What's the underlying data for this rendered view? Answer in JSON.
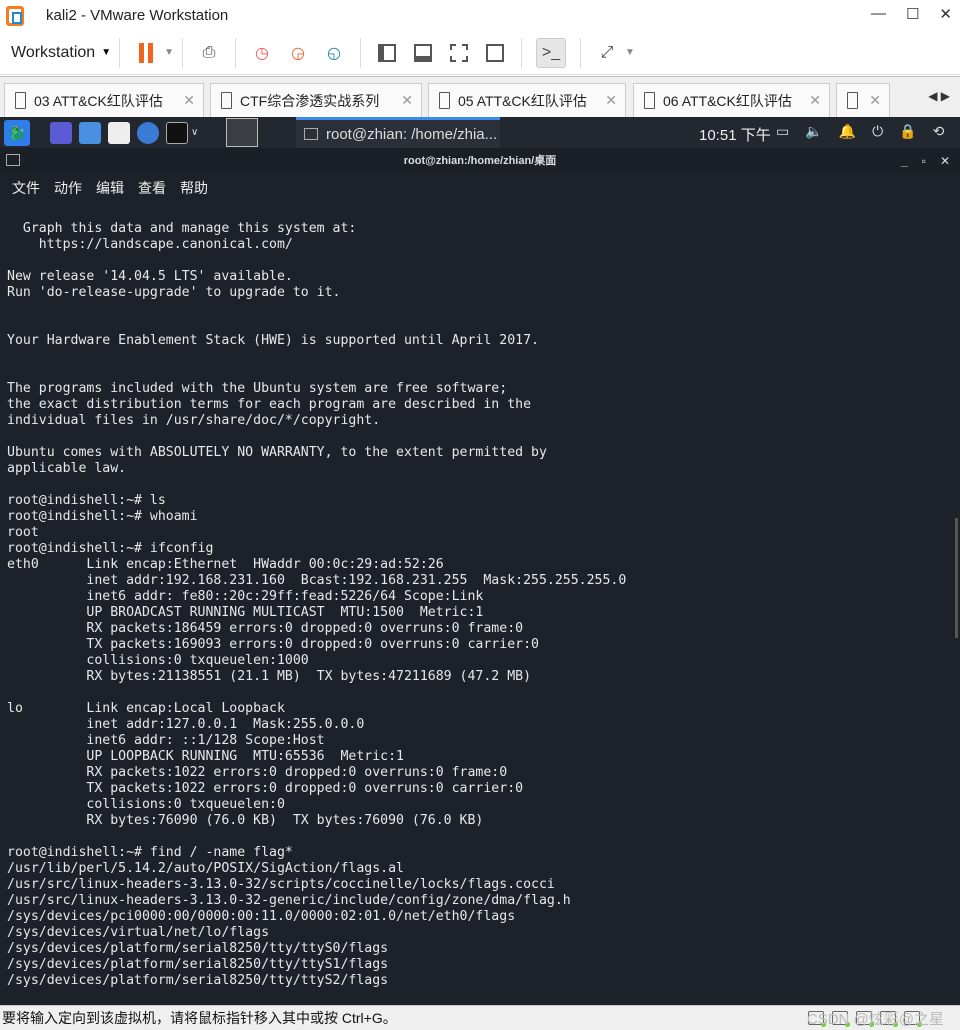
{
  "window": {
    "title": "kali2 - VMware Workstation",
    "controls": [
      "—",
      "☐",
      "✕"
    ]
  },
  "toolbar": {
    "workstation_label": "Workstation"
  },
  "tabs": [
    {
      "label": "03 ATT&CK红队评估"
    },
    {
      "label": "CTF综合渗透实战系列"
    },
    {
      "label": "05 ATT&CK红队评估"
    },
    {
      "label": "06 ATT&CK红队评估"
    },
    {
      "label": ""
    }
  ],
  "panel": {
    "task_label": "root@zhian: /home/zhia...",
    "clock": "10:51 下午"
  },
  "terminal": {
    "title": "root@zhian:/home/zhian/桌面",
    "menu": [
      "文件",
      "动作",
      "编辑",
      "查看",
      "帮助"
    ],
    "lines": [
      "  Graph this data and manage this system at:",
      "    https://landscape.canonical.com/",
      "",
      "New release '14.04.5 LTS' available.",
      "Run 'do-release-upgrade' to upgrade to it.",
      "",
      "",
      "Your Hardware Enablement Stack (HWE) is supported until April 2017.",
      "",
      "",
      "The programs included with the Ubuntu system are free software;",
      "the exact distribution terms for each program are described in the",
      "individual files in /usr/share/doc/*/copyright.",
      "",
      "Ubuntu comes with ABSOLUTELY NO WARRANTY, to the extent permitted by",
      "applicable law.",
      "",
      "root@indishell:~# ls",
      "root@indishell:~# whoami",
      "root",
      "root@indishell:~# ifconfig",
      "eth0      Link encap:Ethernet  HWaddr 00:0c:29:ad:52:26",
      "          inet addr:192.168.231.160  Bcast:192.168.231.255  Mask:255.255.255.0",
      "          inet6 addr: fe80::20c:29ff:fead:5226/64 Scope:Link",
      "          UP BROADCAST RUNNING MULTICAST  MTU:1500  Metric:1",
      "          RX packets:186459 errors:0 dropped:0 overruns:0 frame:0",
      "          TX packets:169093 errors:0 dropped:0 overruns:0 carrier:0",
      "          collisions:0 txqueuelen:1000",
      "          RX bytes:21138551 (21.1 MB)  TX bytes:47211689 (47.2 MB)",
      "",
      "lo        Link encap:Local Loopback",
      "          inet addr:127.0.0.1  Mask:255.0.0.0",
      "          inet6 addr: ::1/128 Scope:Host",
      "          UP LOOPBACK RUNNING  MTU:65536  Metric:1",
      "          RX packets:1022 errors:0 dropped:0 overruns:0 frame:0",
      "          TX packets:1022 errors:0 dropped:0 overruns:0 carrier:0",
      "          collisions:0 txqueuelen:0",
      "          RX bytes:76090 (76.0 KB)  TX bytes:76090 (76.0 KB)",
      "",
      "root@indishell:~# find / -name flag*",
      "/usr/lib/perl/5.14.2/auto/POSIX/SigAction/flags.al",
      "/usr/src/linux-headers-3.13.0-32/scripts/coccinelle/locks/flags.cocci",
      "/usr/src/linux-headers-3.13.0-32-generic/include/config/zone/dma/flag.h",
      "/sys/devices/pci0000:00/0000:00:11.0/0000:02:01.0/net/eth0/flags",
      "/sys/devices/virtual/net/lo/flags",
      "/sys/devices/platform/serial8250/tty/ttyS0/flags",
      "/sys/devices/platform/serial8250/tty/ttyS1/flags",
      "/sys/devices/platform/serial8250/tty/ttyS2/flags"
    ]
  },
  "status": {
    "text": "要将输入定向到该虚拟机，请将鼠标指针移入其中或按 Ctrl+G。",
    "watermark": "CSDN @炫彩@之星"
  },
  "colors": {
    "accent": "#f0641e",
    "terminal_bg": "#1d2129",
    "panel_highlight": "#3b8af2"
  }
}
